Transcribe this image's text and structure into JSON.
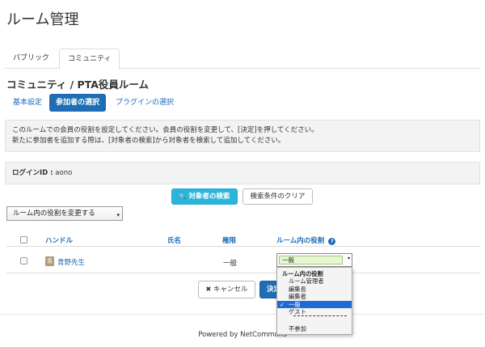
{
  "page": {
    "title": "ルーム管理"
  },
  "tabs": [
    {
      "label": "パブリック",
      "active": false
    },
    {
      "label": "コミュニティ",
      "active": true
    }
  ],
  "room": {
    "title": "コミュニティ / PTA役員ルーム"
  },
  "pills": [
    {
      "label": "基本設定",
      "active": false
    },
    {
      "label": "参加者の選択",
      "active": true
    },
    {
      "label": "プラグインの選択",
      "active": false
    }
  ],
  "info": {
    "line1": "このルームでの会員の役割を設定してください。会員の役割を変更して、[決定]を押してください。",
    "line2": "新たに参加者を追加する際は、[対象者の検索]から対象者を検索して追加してください。"
  },
  "login": {
    "label": "ログインID :",
    "value": "aono"
  },
  "buttons": {
    "search_icon": "🔍",
    "search": "対象者の検索",
    "clear": "検索条件のクリア",
    "cancel_icon": "✖",
    "cancel": "キャンセル",
    "decide": "決定"
  },
  "bulk_role_select": {
    "value": "ルーム内の役割を変更する",
    "arrow": "▾"
  },
  "table": {
    "headers": {
      "handle": "ハンドル",
      "name": "氏名",
      "authority": "権限",
      "role": "ルーム内の役割",
      "help_icon": "?"
    },
    "rows": [
      {
        "avatar": "青",
        "handle": "青野先生",
        "name": "",
        "authority": "一般",
        "role": "一般"
      }
    ]
  },
  "role_dropdown": {
    "arrow": "▾",
    "header": "ルーム内の役割",
    "options": [
      "ルーム管理者",
      "編集長",
      "編集者",
      "一般",
      "ゲスト"
    ],
    "selected": "一般",
    "check": "✓",
    "extra": "不参加"
  },
  "footer": {
    "text": "Powered by NetCommons"
  },
  "colors": {
    "primary": "#1f6db5",
    "info": "#2bb5dc",
    "selected_option": "#1f6bd6"
  }
}
